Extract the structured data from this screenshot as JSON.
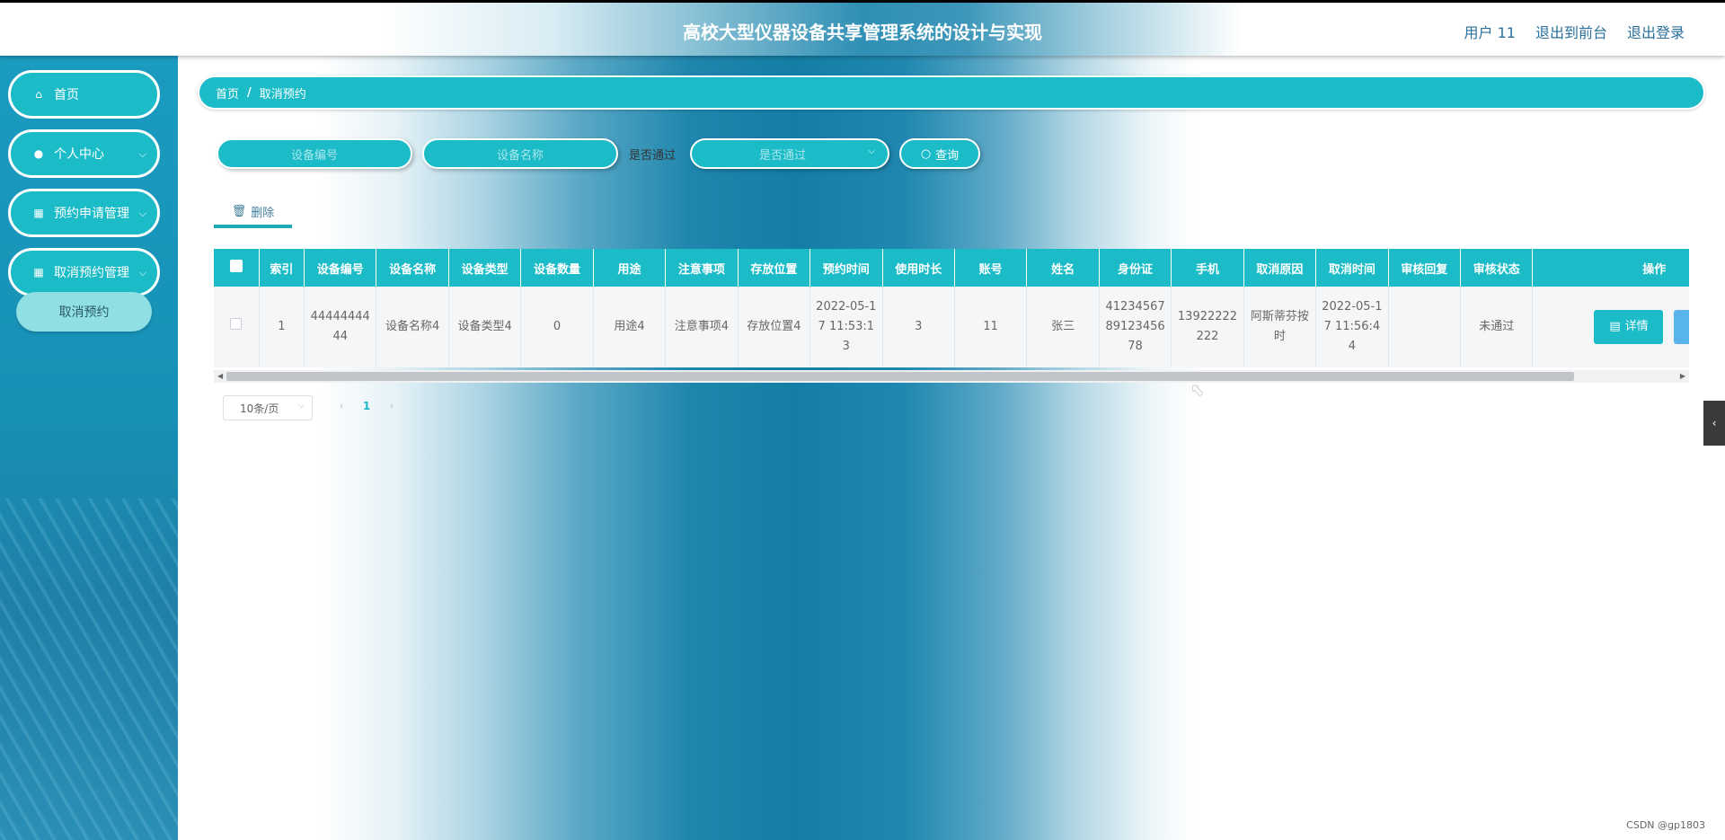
{
  "header": {
    "title": "高校大型仪器设备共享管理系统的设计与实现",
    "user": "用户 11",
    "exit_front": "退出到前台",
    "logout": "退出登录"
  },
  "sidebar": {
    "items": [
      {
        "label": "首页",
        "icon": "home-icon"
      },
      {
        "label": "个人中心",
        "icon": "user-icon"
      },
      {
        "label": "预约申请管理",
        "icon": "grid-icon"
      },
      {
        "label": "取消预约管理",
        "icon": "grid-icon"
      }
    ],
    "submenu": {
      "label": "取消预约"
    }
  },
  "breadcrumb": {
    "home": "首页",
    "sep": "/",
    "current": "取消预约"
  },
  "search": {
    "device_no_placeholder": "设备编号",
    "device_name_placeholder": "设备名称",
    "passed_label": "是否通过",
    "passed_select_placeholder": "是否通过",
    "query_label": "查询"
  },
  "toolbar": {
    "delete_label": "删除"
  },
  "table": {
    "headers": [
      "索引",
      "设备编号",
      "设备名称",
      "设备类型",
      "设备数量",
      "用途",
      "注意事项",
      "存放位置",
      "预约时间",
      "使用时长",
      "账号",
      "姓名",
      "身份证",
      "手机",
      "取消原因",
      "取消时间",
      "审核回复",
      "审核状态",
      "操作"
    ],
    "rows": [
      {
        "index": "1",
        "device_no": "4444444444",
        "device_name": "设备名称4",
        "device_type": "设备类型4",
        "quantity": "0",
        "purpose": "用途4",
        "notes": "注意事项4",
        "location": "存放位置4",
        "booking_time": "2022-05-17 11:53:13",
        "duration": "3",
        "account": "11",
        "name": "张三",
        "id_card": "412345678912345678",
        "phone": "13922222222",
        "cancel_reason": "阿斯蒂芬按时",
        "cancel_time": "2022-05-17 11:56:44",
        "review_reply": "",
        "review_status": "未通过",
        "detail_label": "详情"
      }
    ]
  },
  "pagination": {
    "page_size": "10条/页",
    "prev": "‹",
    "current_page": "1",
    "next": "›"
  },
  "watermark": "CSDN @gp1803",
  "colors": {
    "accent": "#1bbcc7",
    "sidebar": "#1b9bc0"
  }
}
